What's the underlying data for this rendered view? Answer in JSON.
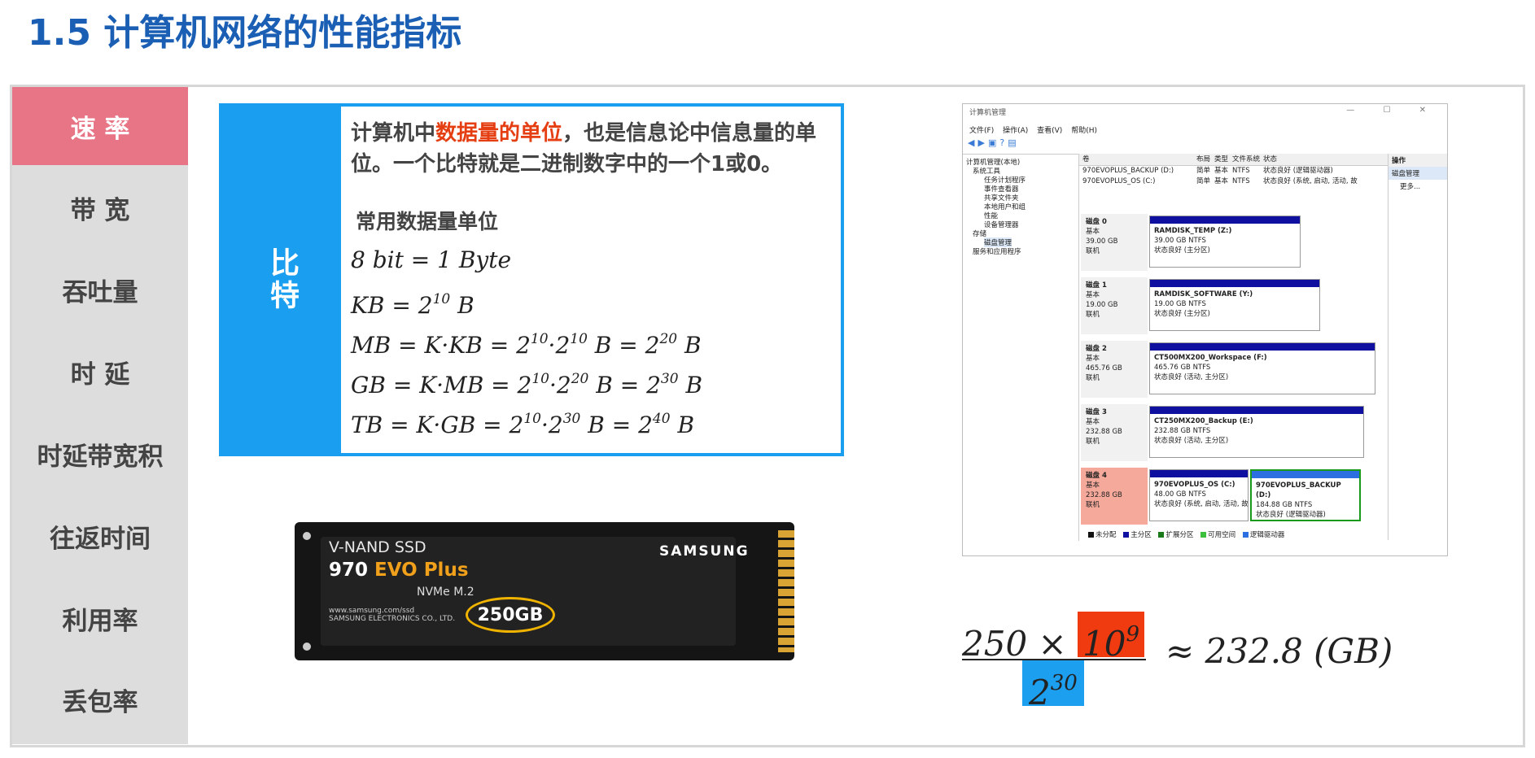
{
  "page_title": "1.5 计算机网络的性能指标",
  "sidebar": {
    "items": [
      {
        "label": "速 率",
        "active": true
      },
      {
        "label": "带 宽"
      },
      {
        "label": "吞吐量"
      },
      {
        "label": "时 延"
      },
      {
        "label": "时延带宽积"
      },
      {
        "label": "往返时间"
      },
      {
        "label": "利用率"
      },
      {
        "label": "丢包率"
      }
    ]
  },
  "card": {
    "tag": "比特",
    "def_pre": "计算机中",
    "def_highlight": "数据量的单位",
    "def_post": "，也是信息论中信息量的单位。一个比特就是二进制数字中的一个1或0。",
    "units_title": "常用数据量单位",
    "equations": {
      "e1": "8  bit  =  1  Byte",
      "e2a": "KB  =  2",
      "e2b": "10",
      "e2c": "  B",
      "e3a": "MB  =  K·KB  =  2",
      "e3b": "10",
      "e3c": "·2",
      "e3d": "10",
      "e3e": "  B  =  2",
      "e3f": "20",
      "e3g": "  B",
      "e4a": "GB  =  K·MB  =  2",
      "e4b": "10",
      "e4c": "·2",
      "e4d": "20",
      "e4e": "  B  =  2",
      "e4f": "30",
      "e4g": "  B",
      "e5a": "TB  =  K·GB  =  2",
      "e5b": "10",
      "e5c": "·2",
      "e5d": "30",
      "e5e": "  B  =  2",
      "e5f": "40",
      "e5g": "  B"
    }
  },
  "ssd": {
    "line1": "V-NAND SSD",
    "model_num": "970 ",
    "model_evo": "EVO Plus",
    "line3": "NVMe M.2",
    "line4": "www.samsung.com/ssd",
    "line5": "SAMSUNG ELECTRONICS CO., LTD.",
    "brand": "SAMSUNG",
    "capacity": "250GB"
  },
  "disk_mgmt": {
    "title": "计算机管理",
    "controls": "— ☐ ✕",
    "menu": [
      "文件(F)",
      "操作(A)",
      "查看(V)",
      "帮助(H)"
    ],
    "tree": [
      "计算机管理(本地)",
      "系统工具",
      "任务计划程序",
      "事件查看器",
      "共享文件夹",
      "本地用户和组",
      "性能",
      "设备管理器",
      "存储",
      "磁盘管理",
      "服务和应用程序"
    ],
    "vol_headers": [
      "卷",
      "布局",
      "类型",
      "文件系统",
      "状态"
    ],
    "volumes": [
      [
        "970EVOPLUS_BACKUP (D:)",
        "简单",
        "基本",
        "NTFS",
        "状态良好 (逻辑驱动器)"
      ],
      [
        "970EVOPLUS_OS (C:)",
        "简单",
        "基本",
        "NTFS",
        "状态良好 (系统, 启动, 活动, 故"
      ]
    ],
    "actions": {
      "header": "操作",
      "item": "磁盘管理",
      "more": "更多..."
    },
    "disks": [
      {
        "name": "磁盘 0",
        "type": "基本",
        "size": "39.00 GB",
        "status": "联机",
        "parts": [
          {
            "name": "RAMDISK_TEMP  (Z:)",
            "size": "39.00 GB NTFS",
            "status": "状态良好 (主分区)"
          }
        ]
      },
      {
        "name": "磁盘 1",
        "type": "基本",
        "size": "19.00 GB",
        "status": "联机",
        "parts": [
          {
            "name": "RAMDISK_SOFTWARE  (Y:)",
            "size": "19.00 GB NTFS",
            "status": "状态良好 (主分区)"
          }
        ]
      },
      {
        "name": "磁盘 2",
        "type": "基本",
        "size": "465.76 GB",
        "status": "联机",
        "parts": [
          {
            "name": "CT500MX200_Workspace  (F:)",
            "size": "465.76 GB NTFS",
            "status": "状态良好 (活动, 主分区)"
          }
        ]
      },
      {
        "name": "磁盘 3",
        "type": "基本",
        "size": "232.88 GB",
        "status": "联机",
        "parts": [
          {
            "name": "CT250MX200_Backup  (E:)",
            "size": "232.88 GB NTFS",
            "status": "状态良好 (活动, 主分区)"
          }
        ]
      },
      {
        "name": "磁盘 4",
        "type": "基本",
        "size": "232.88 GB",
        "status": "联机",
        "parts": [
          {
            "name": "970EVOPLUS_OS  (C:)",
            "size": "48.00 GB NTFS",
            "status": "状态良好 (系统, 启动, 活动, 故"
          },
          {
            "name": "970EVOPLUS_BACKUP  (D:)",
            "size": "184.88 GB NTFS",
            "status": "状态良好 (逻辑驱动器)"
          }
        ]
      }
    ],
    "legend": [
      "未分配",
      "主分区",
      "扩展分区",
      "可用空间",
      "逻辑驱动器"
    ],
    "legend_colors": [
      "#111111",
      "#1010a0",
      "#1a7a1a",
      "#3cc03c",
      "#2b6fe0"
    ]
  },
  "formula": {
    "num_a": "250  ×  ",
    "num_b": "10",
    "num_b_exp": "9",
    "den": "2",
    "den_exp": "30",
    "result": "≈  232.8  (GB)"
  },
  "colors": {
    "title": "#1a5fb4",
    "active_tab": "#e87585",
    "card_border": "#1a9ff0",
    "highlight_text": "#e53e12",
    "formula_red": "#f03a10",
    "formula_blue": "#1d9fef"
  }
}
